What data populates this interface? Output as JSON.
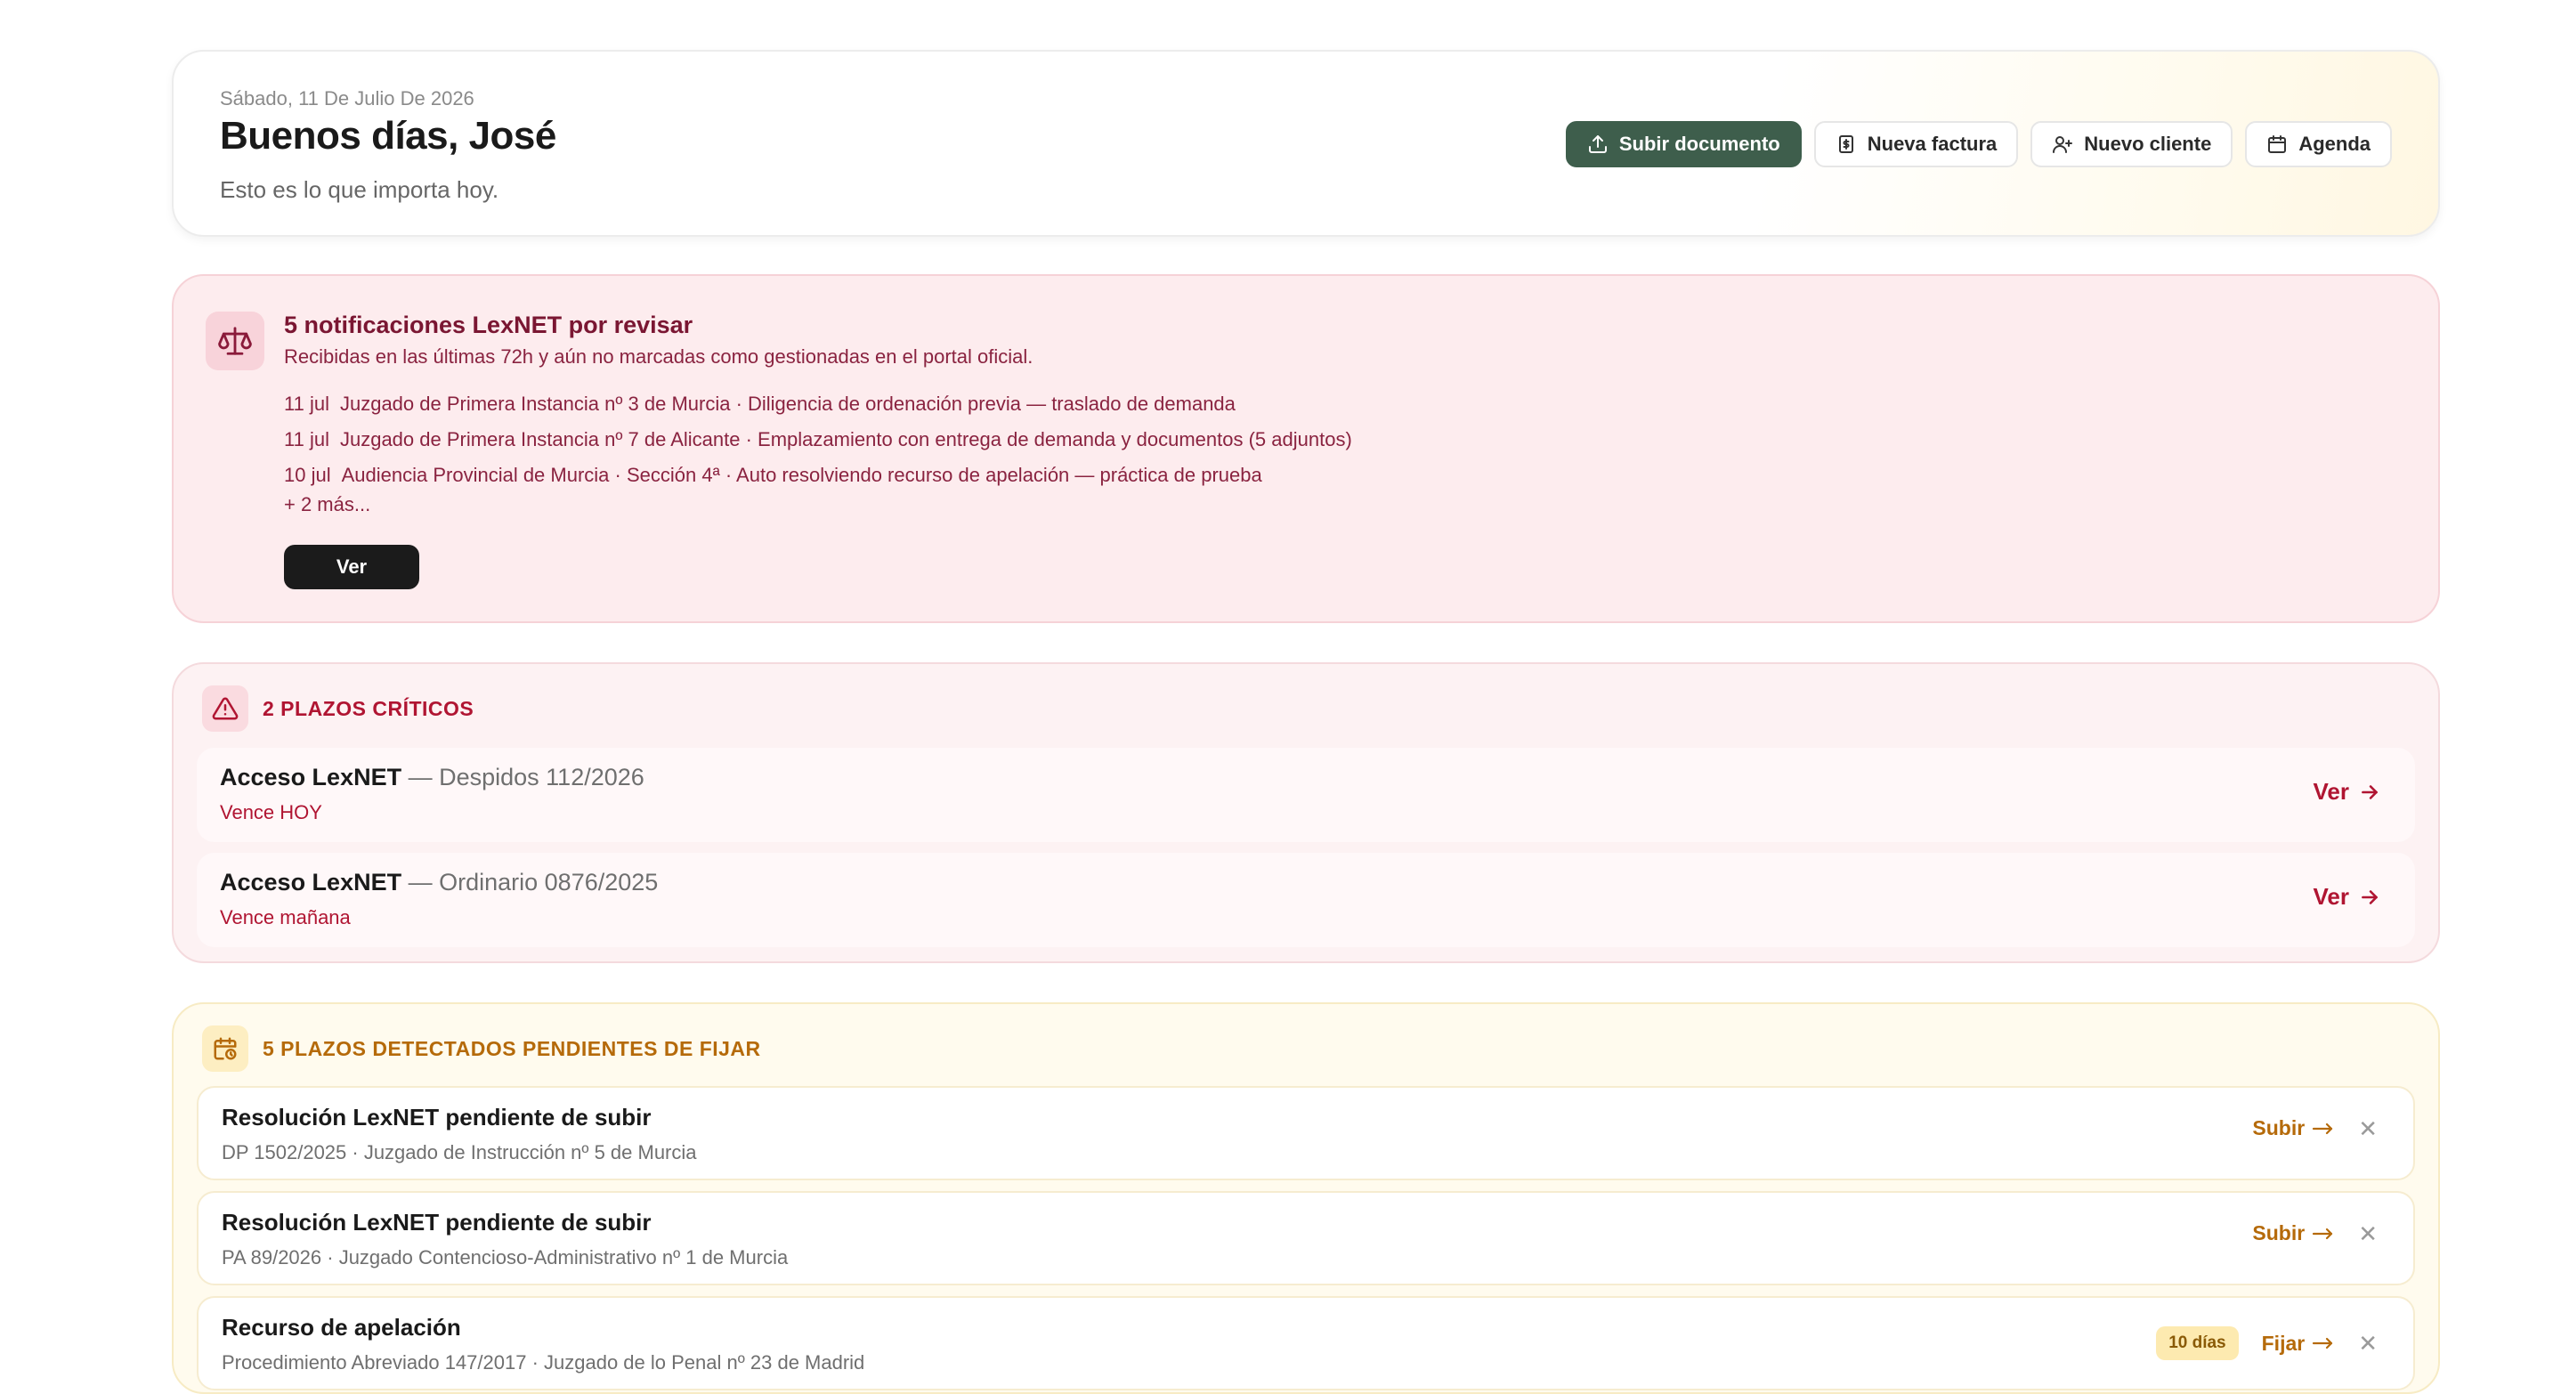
{
  "header": {
    "date": "Sábado, 11 De Julio De 2026",
    "greeting": "Buenos días, José",
    "subtitle": "Esto es lo que importa hoy.",
    "actions": [
      {
        "label": "Subir documento",
        "icon": "upload-icon"
      },
      {
        "label": "Nueva factura",
        "icon": "invoice-icon"
      },
      {
        "label": "Nuevo cliente",
        "icon": "user-plus-icon"
      },
      {
        "label": "Agenda",
        "icon": "calendar-icon"
      }
    ]
  },
  "lexnet": {
    "icon": "scales-icon",
    "title": "5 notificaciones LexNET por revisar",
    "subtitle": "Recibidas en las últimas 72h y aún no marcadas como gestionadas en el portal oficial.",
    "items": [
      {
        "date": "11 jul",
        "text": "Juzgado de Primera Instancia nº 3 de Murcia · Diligencia de ordenación previa — traslado de demanda"
      },
      {
        "date": "11 jul",
        "text": "Juzgado de Primera Instancia nº 7 de Alicante · Emplazamiento con entrega de demanda y documentos (5 adjuntos)"
      },
      {
        "date": "10 jul",
        "text": "Audiencia Provincial de Murcia · Sección 4ª · Auto resolviendo recurso de apelación — práctica de prueba"
      }
    ],
    "more": "+ 2 más...",
    "button": "Ver"
  },
  "critical": {
    "icon": "warning-icon",
    "heading": "2 PLAZOS CRÍTICOS",
    "rows": [
      {
        "name": "Acceso LexNET",
        "detail": "— Despidos 112/2026",
        "due": "Vence HOY",
        "link": "Ver"
      },
      {
        "name": "Acceso LexNET",
        "detail": "— Ordinario 0876/2025",
        "due": "Vence mañana",
        "link": "Ver"
      }
    ]
  },
  "pending": {
    "icon": "calendar-clock-icon",
    "heading": "5 PLAZOS DETECTADOS PENDIENTES DE FIJAR",
    "rows": [
      {
        "title": "Resolución LexNET pendiente de subir",
        "sub": "DP 1502/2025 · Juzgado de Instrucción nº 5 de Murcia",
        "action": "Subir",
        "badge": ""
      },
      {
        "title": "Resolución LexNET pendiente de subir",
        "sub": "PA 89/2026 · Juzgado Contencioso-Administrativo nº 1 de Murcia",
        "action": "Subir",
        "badge": ""
      },
      {
        "title": "Recurso de apelación",
        "sub": "Procedimiento Abreviado 147/2017 · Juzgado de lo Penal nº 23 de Madrid",
        "action": "Fijar",
        "badge": "10 días"
      }
    ]
  },
  "colors": {
    "primary": "#3e5e4c",
    "critical": "#b01532",
    "lexnet": "#7a1632",
    "pending": "#b56a0a"
  }
}
